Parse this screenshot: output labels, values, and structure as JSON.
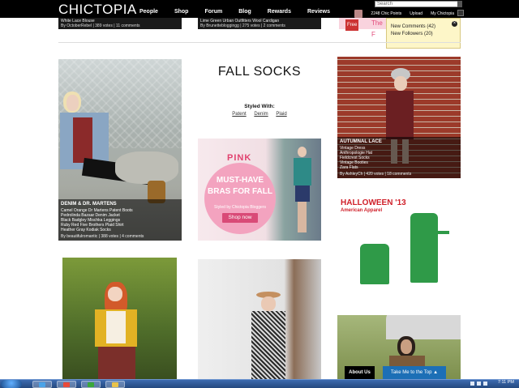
{
  "header": {
    "logo": "CHICTOPIA",
    "nav": [
      "People",
      "Shop",
      "Forum",
      "Blog",
      "Rewards",
      "Reviews"
    ],
    "search_placeholder": "Search",
    "user": {
      "points": "2248 Chic Points",
      "upload": "Upload",
      "my": "My Chictopia"
    }
  },
  "prev_strip": [
    {
      "t1": "White Lace Blouse",
      "t2": "By OctoberRebel | 389 votes | 11 comments"
    },
    {
      "t1": "Lime Green Urban Outfitters Wool Cardigan",
      "t2": "By Brunettebloggingg | 275 votes | 2 comments"
    }
  ],
  "pink_peek": {
    "label": "Free",
    "text": "The F"
  },
  "notifications": {
    "items": [
      "New Comments (42)",
      "New Followers (20)"
    ]
  },
  "center": {
    "title": "FALL SOCKS",
    "styled_with": "Styled With:",
    "links": [
      "Patent",
      "Denim",
      "Plaid"
    ]
  },
  "promo": {
    "pink": "PINK",
    "line1": "MUST-HAVE",
    "line2": "BRAS FOR FALL",
    "sub": "Styled by Chictopia Bloggers",
    "button": "Shop now"
  },
  "cards": [
    {
      "title": "DENIM & DR. MARTENS",
      "lines": [
        "Camel Orange Dr Martens Patent Boots",
        "Pedrolinda Bazaar Denim Jacket",
        "Black Badgley Mischka Leggings",
        "Ruby Red Five Brothers Plaid Shirt",
        "Heather Gray Kodiak Socks"
      ],
      "foot": "By beautifulromantic | 388 votes | 4 comments"
    },
    {
      "title": "AUTUMNAL LACE",
      "lines": [
        "Vintage Dress",
        "Anthropologie Hat",
        "Fieldcrest Socks",
        "Vintage Booties",
        "Zara Flats"
      ],
      "foot": "By AshleyCh | 420 votes | 18 comments"
    }
  ],
  "halloween": {
    "title": "HALLOWEEN '13",
    "sub": "American Apparel"
  },
  "bottom": {
    "about": "About Us",
    "top": "Take Me to the Top ▲"
  },
  "taskbar": {
    "clock": "7:11 PM"
  },
  "colors": {
    "brand": "#000000",
    "accent_pink": "#e1426f",
    "promo_circle": "#f3a3bf",
    "notif_bg": "#fdf6c8",
    "take_top": "#1c6fb6",
    "halloween_red": "#d0202a",
    "halloween_green": "#2f9a48"
  }
}
